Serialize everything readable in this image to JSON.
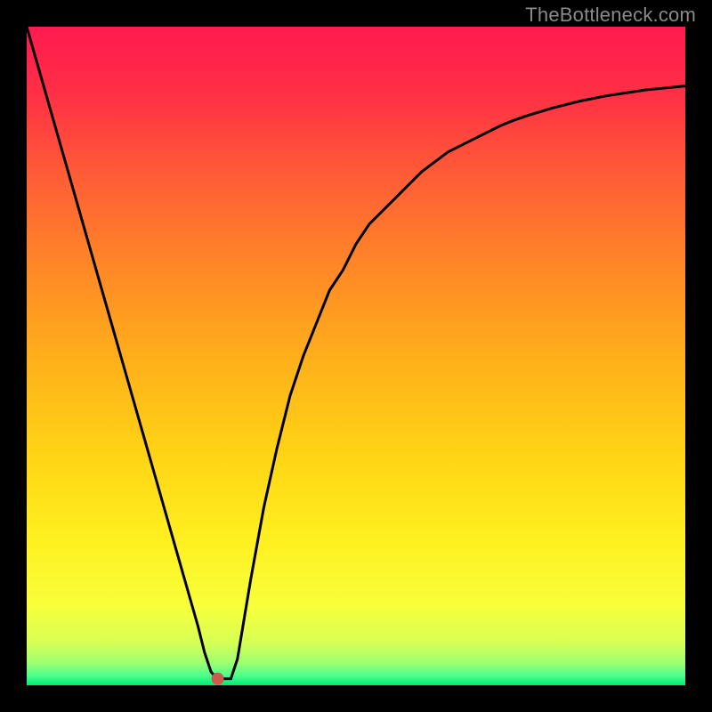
{
  "attribution": "TheBottleneck.com",
  "chart_data": {
    "type": "line",
    "title": "",
    "xlabel": "",
    "ylabel": "",
    "xlim": [
      0,
      100
    ],
    "ylim": [
      0,
      100
    ],
    "grid": false,
    "legend": false,
    "x": [
      0,
      2,
      4,
      6,
      8,
      10,
      12,
      14,
      16,
      18,
      20,
      22,
      24,
      26,
      27,
      28,
      29,
      30,
      31,
      32,
      33,
      34,
      36,
      38,
      40,
      42,
      44,
      46,
      48,
      50,
      52,
      54,
      56,
      58,
      60,
      62,
      64,
      66,
      68,
      70,
      72,
      74,
      76,
      78,
      80,
      82,
      84,
      86,
      88,
      90,
      92,
      94,
      96,
      98,
      100
    ],
    "values": [
      100,
      93,
      86,
      79,
      72,
      65,
      58,
      51,
      44,
      37,
      30,
      23,
      16,
      9,
      5,
      2,
      1,
      1,
      1,
      4,
      10,
      16,
      27,
      36,
      44,
      50,
      55,
      60,
      63,
      67,
      70,
      72,
      74,
      76,
      78,
      79.5,
      81,
      82,
      83,
      84,
      85,
      85.8,
      86.5,
      87.1,
      87.7,
      88.2,
      88.7,
      89.1,
      89.5,
      89.8,
      90.1,
      90.4,
      90.6,
      90.8,
      91
    ],
    "marker": {
      "x": 29,
      "y": 1,
      "color": "#cc5a4d"
    },
    "background_gradient": [
      {
        "offset": 0.0,
        "color": "#ff1a4f"
      },
      {
        "offset": 0.1,
        "color": "#ff2f45"
      },
      {
        "offset": 0.22,
        "color": "#ff5a37"
      },
      {
        "offset": 0.35,
        "color": "#ff8328"
      },
      {
        "offset": 0.5,
        "color": "#ffae1b"
      },
      {
        "offset": 0.65,
        "color": "#ffd414"
      },
      {
        "offset": 0.78,
        "color": "#fff021"
      },
      {
        "offset": 0.88,
        "color": "#f7ff3a"
      },
      {
        "offset": 0.935,
        "color": "#d7ff55"
      },
      {
        "offset": 0.965,
        "color": "#a0ff70"
      },
      {
        "offset": 0.985,
        "color": "#4dff8c"
      },
      {
        "offset": 1.0,
        "color": "#00e87a"
      }
    ]
  }
}
